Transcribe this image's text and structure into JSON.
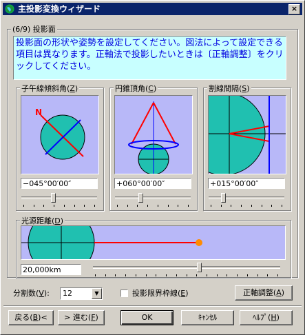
{
  "window": {
    "title": "主投影変換ウィザード",
    "close_label": "×"
  },
  "step": {
    "label": "(6/9) 投影面"
  },
  "description": "投影面の形状や姿勢を設定してください。図法によって設定できる項目は異なります。正軸法で投影したいときは〔正軸調整〕をクリックしてください。",
  "panels": {
    "meridian": {
      "label": "子午線傾斜角(",
      "key": "Z",
      "suffix": ")",
      "value": "−045°00′00″",
      "north_label": "N",
      "slider": 0.42
    },
    "cone": {
      "label": "円錐頂角(",
      "key": "C",
      "suffix": ")",
      "value": "+060°00′00″",
      "slider": 0.33
    },
    "graticule": {
      "label": "割線間隔(",
      "key": "S",
      "suffix": ")",
      "value": "+015°00′00″",
      "slider": 0.17
    }
  },
  "light": {
    "label": "光源距離(",
    "key": "D",
    "suffix": ")",
    "value": "20,000km",
    "slider": 0.57
  },
  "divisions": {
    "label": "分割数(",
    "key": "V",
    "suffix": "):",
    "value": "12"
  },
  "boundary": {
    "label": "投影限界枠線(",
    "key": "E",
    "suffix": ")",
    "checked": false
  },
  "buttons": {
    "adjust": {
      "label": "正軸調整(",
      "key": "A",
      "suffix": ")"
    },
    "back": {
      "label": "戻る(",
      "key": "B",
      "suffix": ")<"
    },
    "next": {
      "label": "> 進む(",
      "key": "F",
      "suffix": ")"
    },
    "ok": "OK",
    "cancel": "ｷｬﾝｾﾙ",
    "help": {
      "label": "ﾍﾙﾌﾟ(",
      "key": "H",
      "suffix": ")"
    }
  },
  "colors": {
    "panel_bg": "#b8b8f8",
    "earth": "#20c0b0",
    "red": "#ff0000",
    "blue": "#0000ff",
    "orange": "#ff8c00",
    "desc_bg": "#c8ffff",
    "desc_text": "#0000e0"
  }
}
